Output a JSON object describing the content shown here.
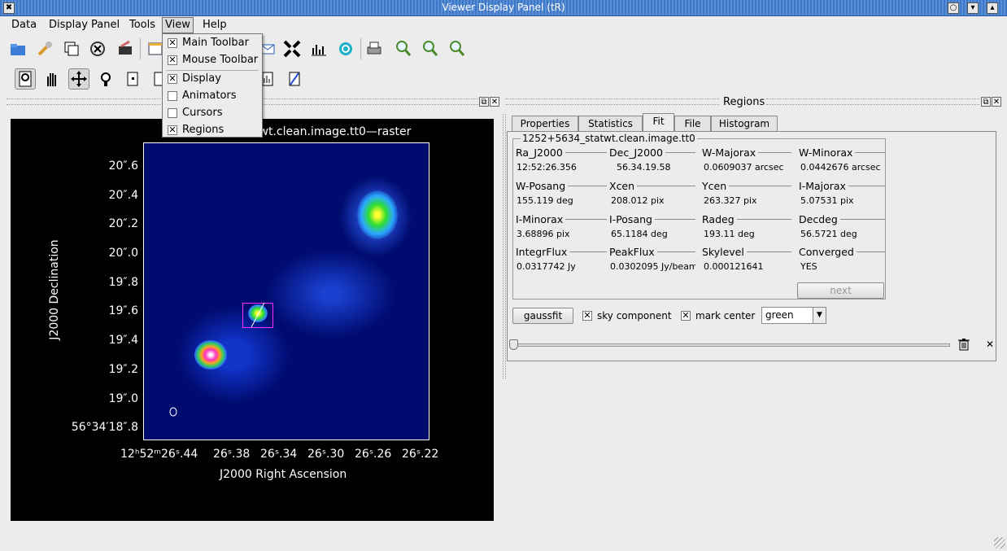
{
  "window": {
    "title": "Viewer Display Panel (tR)"
  },
  "menubar": {
    "items": [
      {
        "label": "Data"
      },
      {
        "label": "Display Panel"
      },
      {
        "label": "Tools"
      },
      {
        "label": "View"
      },
      {
        "label": "Help"
      }
    ]
  },
  "view_menu": {
    "items": [
      {
        "label": "Main Toolbar",
        "checked": true
      },
      {
        "label": "Mouse Toolbar",
        "checked": true
      },
      {
        "label": "Display",
        "checked": true
      },
      {
        "label": "Animators",
        "checked": false
      },
      {
        "label": "Cursors",
        "checked": false
      },
      {
        "label": "Regions",
        "checked": true
      }
    ]
  },
  "dock": {
    "regions_title": "Regions"
  },
  "image": {
    "title": "1252+5634_statwt.clean.image.tt0—raster",
    "title_visible": "twt.clean.image.tt0—raster",
    "y_axis_title": "J2000 Declination",
    "x_axis_title": "J2000 Right Ascension",
    "y_ticks": [
      "20″.6",
      "20″.4",
      "20″.2",
      "20″.0",
      "19″.8",
      "19″.6",
      "19″.4",
      "19″.2",
      "19″.0",
      "56°34′18″.8"
    ],
    "x_ticks": [
      "12ʰ52ᵐ26ˢ.44",
      "26ˢ.38",
      "26ˢ.34",
      "26ˢ.30",
      "26ˢ.26",
      "26ˢ.22"
    ]
  },
  "tabs": [
    {
      "label": "Properties"
    },
    {
      "label": "Statistics"
    },
    {
      "label": "Fit"
    },
    {
      "label": "File"
    },
    {
      "label": "Histogram"
    }
  ],
  "fit": {
    "group_title": "1252+5634_statwt.clean.image.tt0",
    "fields": [
      {
        "label": "Ra_J2000",
        "value": "12:52:26.356"
      },
      {
        "label": "Dec_J2000",
        "value": "56.34.19.58"
      },
      {
        "label": "W-Majorax",
        "value": "0.0609037 arcsec"
      },
      {
        "label": "W-Minorax",
        "value": "0.0442676 arcsec"
      },
      {
        "label": "W-Posang",
        "value": "155.119 deg"
      },
      {
        "label": "Xcen",
        "value": "208.012 pix"
      },
      {
        "label": "Ycen",
        "value": "263.327 pix"
      },
      {
        "label": "I-Majorax",
        "value": "5.07531 pix"
      },
      {
        "label": "I-Minorax",
        "value": "3.68896 pix"
      },
      {
        "label": "I-Posang",
        "value": "65.1184 deg"
      },
      {
        "label": "Radeg",
        "value": "193.11 deg"
      },
      {
        "label": "Decdeg",
        "value": "56.5721 deg"
      },
      {
        "label": "IntegrFlux",
        "value": "0.0317742 Jy"
      },
      {
        "label": "PeakFlux",
        "value": "0.0302095 Jy/beam"
      },
      {
        "label": "Skylevel",
        "value": "0.000121641"
      },
      {
        "label": "Converged",
        "value": "YES"
      }
    ],
    "next_label": "next",
    "gaussfit_label": "gaussfit",
    "sky_component": {
      "label": "sky component",
      "checked": true
    },
    "mark_center": {
      "label": "mark center",
      "checked": true
    },
    "color_select": "green"
  },
  "icons": [
    "open-icon",
    "wrench-icon",
    "copy-icon",
    "close-circle-icon",
    "save-icon",
    "print-icon",
    "zoom-in-icon",
    "zoom-out-icon",
    "zoom-fit-icon",
    "trash-icon",
    "close-icon"
  ]
}
